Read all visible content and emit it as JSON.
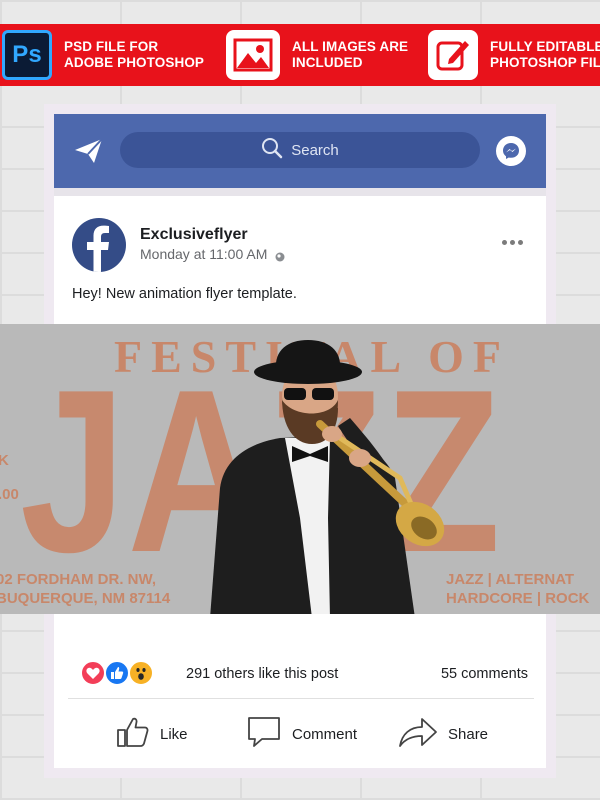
{
  "banner": {
    "items": [
      {
        "icon": "photoshop-logo-icon",
        "logo_text": "Ps",
        "line1": "PSD FILE FOR",
        "line2": "ADOBE PHOTOSHOP"
      },
      {
        "icon": "image-icon",
        "line1": "ALL IMAGES ARE",
        "line2": "INCLUDED"
      },
      {
        "icon": "edit-pencil-icon",
        "line1": "FULLY EDITABLE",
        "line2": "PHOTOSHOP FILE"
      }
    ]
  },
  "header": {
    "search_placeholder": "Search",
    "icons": [
      "send-icon",
      "search-icon",
      "messenger-icon"
    ],
    "bg_color": "#4d68ad"
  },
  "post": {
    "author": "Exclusiveflyer",
    "time": "Monday at 11:00 AM",
    "text": "Hey! New animation flyer template."
  },
  "flyer": {
    "heading": "FESTIVAL OF",
    "title": "JAZZ",
    "side_text": [
      "K",
      ".00"
    ],
    "address_line1": "02 FORDHAM DR. NW,",
    "address_line2": "BUQUERQUE, NM 87114",
    "genres_line1": "JAZZ | ALTERNAT",
    "genres_line2": "HARDCORE | ROCK",
    "accent_color": "#c8876a"
  },
  "stats": {
    "likes": "291 others like this post",
    "comments": "55 comments",
    "reactions": [
      "love-reaction-icon",
      "like-reaction-icon",
      "wow-reaction-icon"
    ]
  },
  "actions": {
    "like": "Like",
    "comment": "Comment",
    "share": "Share"
  }
}
